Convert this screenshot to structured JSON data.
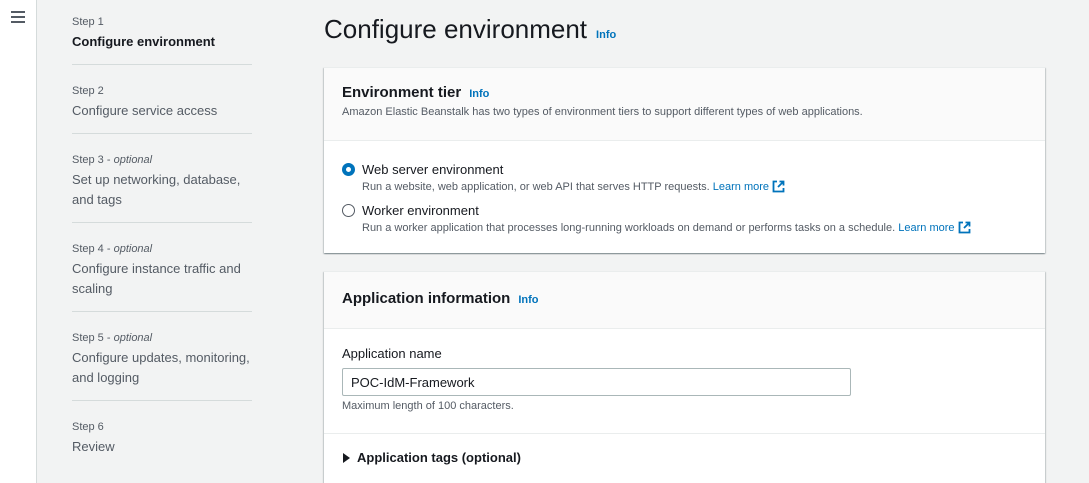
{
  "steps": [
    {
      "num": "Step 1",
      "optional": "",
      "title": "Configure environment",
      "active": true
    },
    {
      "num": "Step 2",
      "optional": "",
      "title": "Configure service access"
    },
    {
      "num": "Step 3 - ",
      "optional": "optional",
      "title": "Set up networking, database, and tags"
    },
    {
      "num": "Step 4 - ",
      "optional": "optional",
      "title": "Configure instance traffic and scaling"
    },
    {
      "num": "Step 5 - ",
      "optional": "optional",
      "title": "Configure updates, monitoring, and logging"
    },
    {
      "num": "Step 6",
      "optional": "",
      "title": "Review"
    }
  ],
  "page": {
    "title": "Configure environment",
    "info": "Info"
  },
  "tier": {
    "title": "Environment tier",
    "info": "Info",
    "description": "Amazon Elastic Beanstalk has two types of environment tiers to support different types of web applications.",
    "options": [
      {
        "label": "Web server environment",
        "desc": "Run a website, web application, or web API that serves HTTP requests.",
        "learn": "Learn more",
        "checked": true
      },
      {
        "label": "Worker environment",
        "desc": "Run a worker application that processes long-running workloads on demand or performs tasks on a schedule.",
        "learn": "Learn more",
        "checked": false
      }
    ]
  },
  "app": {
    "title": "Application information",
    "info": "Info",
    "name_label": "Application name",
    "name_value": "POC-IdM-Framework",
    "constraint": "Maximum length of 100 characters.",
    "tags_label": "Application tags (optional)"
  },
  "icons": {
    "menu": "hamburger-menu-icon",
    "external": "external-link-icon",
    "caret": "caret-right-icon"
  },
  "colors": {
    "link": "#0073bb",
    "text": "#16191f",
    "muted": "#545b64",
    "background": "#f2f3f3"
  }
}
